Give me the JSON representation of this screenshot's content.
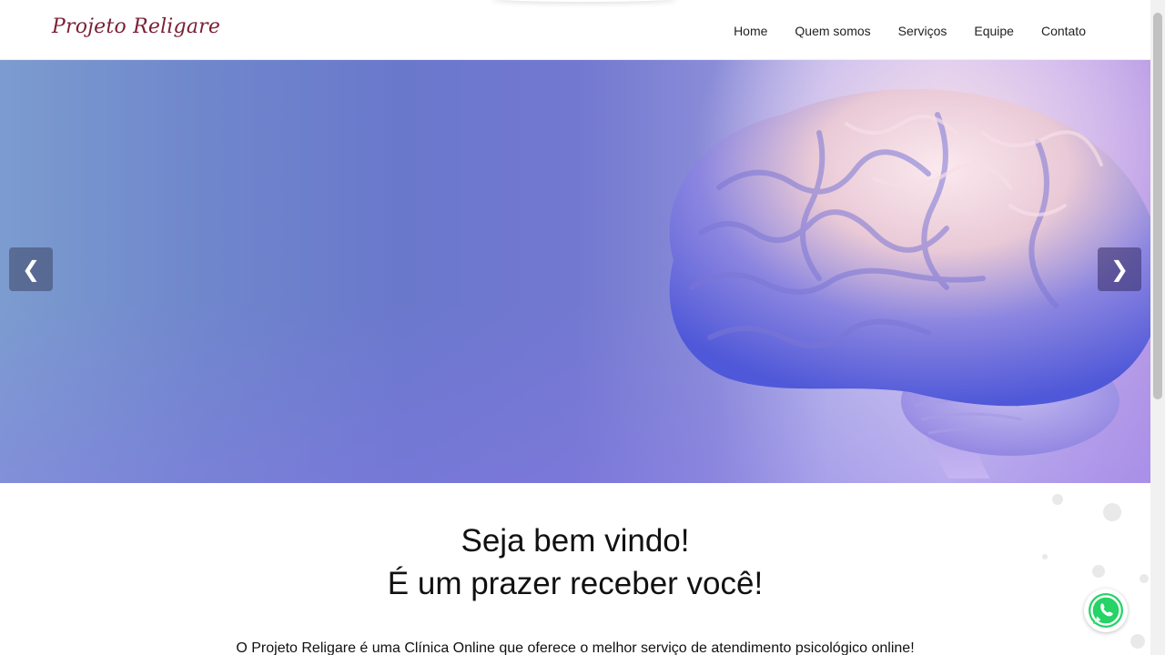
{
  "header": {
    "logo": "Projeto Religare",
    "nav": [
      {
        "label": "Home"
      },
      {
        "label": "Quem somos"
      },
      {
        "label": "Serviços"
      },
      {
        "label": "Equipe"
      },
      {
        "label": "Contato"
      }
    ]
  },
  "hero": {
    "prev_icon": "chevron-left-icon",
    "prev_glyph": "❮",
    "next_icon": "chevron-right-icon",
    "next_glyph": "❯",
    "image": "brain-illustration"
  },
  "welcome": {
    "title_line1": "Seja bem vindo!",
    "title_line2": "É um prazer receber você!",
    "intro": "O Projeto Religare é uma Clínica Online que oferece o melhor serviço de atendimento psicológico online!"
  },
  "floating": {
    "whatsapp_icon": "whatsapp-icon"
  },
  "colors": {
    "brand": "#7a1f35",
    "whatsapp": "#25d366"
  }
}
